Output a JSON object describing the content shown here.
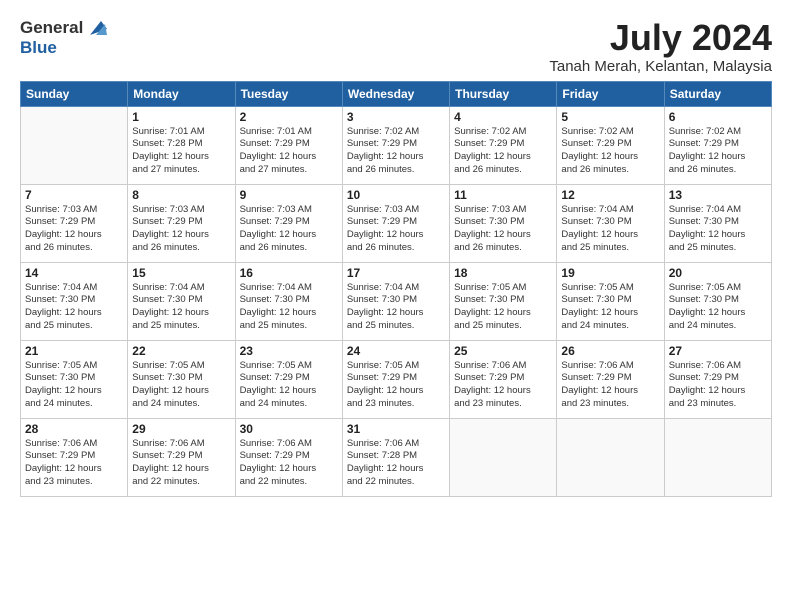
{
  "logo": {
    "general": "General",
    "blue": "Blue"
  },
  "title": "July 2024",
  "location": "Tanah Merah, Kelantan, Malaysia",
  "days_of_week": [
    "Sunday",
    "Monday",
    "Tuesday",
    "Wednesday",
    "Thursday",
    "Friday",
    "Saturday"
  ],
  "weeks": [
    [
      {
        "day": "",
        "info": ""
      },
      {
        "day": "1",
        "info": "Sunrise: 7:01 AM\nSunset: 7:28 PM\nDaylight: 12 hours\nand 27 minutes."
      },
      {
        "day": "2",
        "info": "Sunrise: 7:01 AM\nSunset: 7:29 PM\nDaylight: 12 hours\nand 27 minutes."
      },
      {
        "day": "3",
        "info": "Sunrise: 7:02 AM\nSunset: 7:29 PM\nDaylight: 12 hours\nand 26 minutes."
      },
      {
        "day": "4",
        "info": "Sunrise: 7:02 AM\nSunset: 7:29 PM\nDaylight: 12 hours\nand 26 minutes."
      },
      {
        "day": "5",
        "info": "Sunrise: 7:02 AM\nSunset: 7:29 PM\nDaylight: 12 hours\nand 26 minutes."
      },
      {
        "day": "6",
        "info": "Sunrise: 7:02 AM\nSunset: 7:29 PM\nDaylight: 12 hours\nand 26 minutes."
      }
    ],
    [
      {
        "day": "7",
        "info": "Sunrise: 7:03 AM\nSunset: 7:29 PM\nDaylight: 12 hours\nand 26 minutes."
      },
      {
        "day": "8",
        "info": "Sunrise: 7:03 AM\nSunset: 7:29 PM\nDaylight: 12 hours\nand 26 minutes."
      },
      {
        "day": "9",
        "info": "Sunrise: 7:03 AM\nSunset: 7:29 PM\nDaylight: 12 hours\nand 26 minutes."
      },
      {
        "day": "10",
        "info": "Sunrise: 7:03 AM\nSunset: 7:29 PM\nDaylight: 12 hours\nand 26 minutes."
      },
      {
        "day": "11",
        "info": "Sunrise: 7:03 AM\nSunset: 7:30 PM\nDaylight: 12 hours\nand 26 minutes."
      },
      {
        "day": "12",
        "info": "Sunrise: 7:04 AM\nSunset: 7:30 PM\nDaylight: 12 hours\nand 25 minutes."
      },
      {
        "day": "13",
        "info": "Sunrise: 7:04 AM\nSunset: 7:30 PM\nDaylight: 12 hours\nand 25 minutes."
      }
    ],
    [
      {
        "day": "14",
        "info": "Sunrise: 7:04 AM\nSunset: 7:30 PM\nDaylight: 12 hours\nand 25 minutes."
      },
      {
        "day": "15",
        "info": "Sunrise: 7:04 AM\nSunset: 7:30 PM\nDaylight: 12 hours\nand 25 minutes."
      },
      {
        "day": "16",
        "info": "Sunrise: 7:04 AM\nSunset: 7:30 PM\nDaylight: 12 hours\nand 25 minutes."
      },
      {
        "day": "17",
        "info": "Sunrise: 7:04 AM\nSunset: 7:30 PM\nDaylight: 12 hours\nand 25 minutes."
      },
      {
        "day": "18",
        "info": "Sunrise: 7:05 AM\nSunset: 7:30 PM\nDaylight: 12 hours\nand 25 minutes."
      },
      {
        "day": "19",
        "info": "Sunrise: 7:05 AM\nSunset: 7:30 PM\nDaylight: 12 hours\nand 24 minutes."
      },
      {
        "day": "20",
        "info": "Sunrise: 7:05 AM\nSunset: 7:30 PM\nDaylight: 12 hours\nand 24 minutes."
      }
    ],
    [
      {
        "day": "21",
        "info": "Sunrise: 7:05 AM\nSunset: 7:30 PM\nDaylight: 12 hours\nand 24 minutes."
      },
      {
        "day": "22",
        "info": "Sunrise: 7:05 AM\nSunset: 7:30 PM\nDaylight: 12 hours\nand 24 minutes."
      },
      {
        "day": "23",
        "info": "Sunrise: 7:05 AM\nSunset: 7:29 PM\nDaylight: 12 hours\nand 24 minutes."
      },
      {
        "day": "24",
        "info": "Sunrise: 7:05 AM\nSunset: 7:29 PM\nDaylight: 12 hours\nand 23 minutes."
      },
      {
        "day": "25",
        "info": "Sunrise: 7:06 AM\nSunset: 7:29 PM\nDaylight: 12 hours\nand 23 minutes."
      },
      {
        "day": "26",
        "info": "Sunrise: 7:06 AM\nSunset: 7:29 PM\nDaylight: 12 hours\nand 23 minutes."
      },
      {
        "day": "27",
        "info": "Sunrise: 7:06 AM\nSunset: 7:29 PM\nDaylight: 12 hours\nand 23 minutes."
      }
    ],
    [
      {
        "day": "28",
        "info": "Sunrise: 7:06 AM\nSunset: 7:29 PM\nDaylight: 12 hours\nand 23 minutes."
      },
      {
        "day": "29",
        "info": "Sunrise: 7:06 AM\nSunset: 7:29 PM\nDaylight: 12 hours\nand 22 minutes."
      },
      {
        "day": "30",
        "info": "Sunrise: 7:06 AM\nSunset: 7:29 PM\nDaylight: 12 hours\nand 22 minutes."
      },
      {
        "day": "31",
        "info": "Sunrise: 7:06 AM\nSunset: 7:28 PM\nDaylight: 12 hours\nand 22 minutes."
      },
      {
        "day": "",
        "info": ""
      },
      {
        "day": "",
        "info": ""
      },
      {
        "day": "",
        "info": ""
      }
    ]
  ]
}
